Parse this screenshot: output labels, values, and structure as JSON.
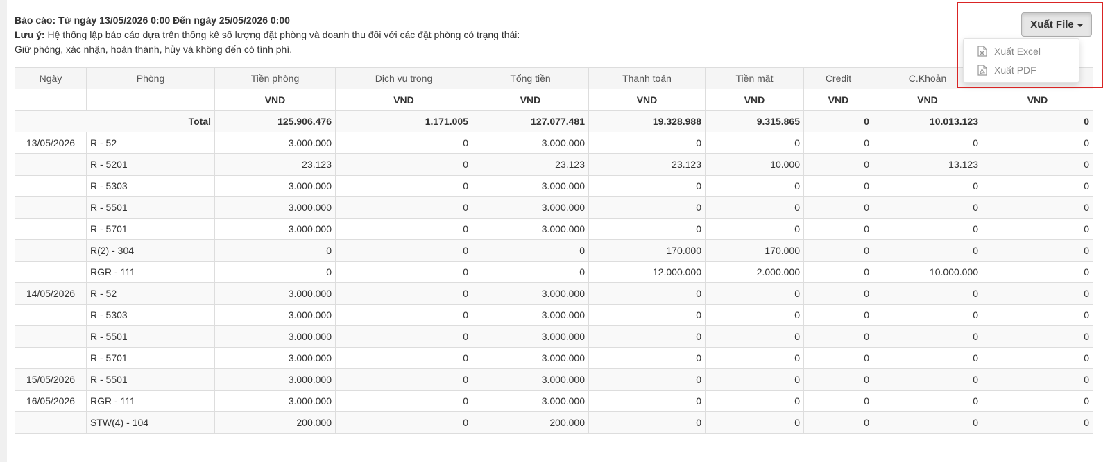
{
  "report": {
    "title": "Báo cáo: Từ ngày 13/05/2026 0:00 Đến ngày 25/05/2026 0:00",
    "note_label": "Lưu ý:",
    "note_text": " Hệ thống lập báo cáo dựa trên thống kê số lượng đặt phòng và doanh thu đối với các đặt phòng có trạng thái:",
    "note_line2": "Giữ phòng, xác nhận, hoàn thành, hủy và không đến có tính phí."
  },
  "export": {
    "button_label": "Xuất File",
    "menu": [
      {
        "label": "Xuất Excel",
        "icon": "excel-file-icon"
      },
      {
        "label": "Xuất PDF",
        "icon": "pdf-file-icon"
      }
    ]
  },
  "table": {
    "columns": [
      "Ngày",
      "Phòng",
      "Tiền phòng",
      "Dịch vụ trong",
      "Tổng tiền",
      "Thanh toán",
      "Tiền mặt",
      "Credit",
      "C.Khoản",
      ""
    ],
    "units": [
      "",
      "",
      "VND",
      "VND",
      "VND",
      "VND",
      "VND",
      "VND",
      "VND",
      "VND"
    ],
    "total": {
      "label": "Total",
      "values": [
        "125.906.476",
        "1.171.005",
        "127.077.481",
        "19.328.988",
        "9.315.865",
        "0",
        "10.013.123",
        "0"
      ]
    },
    "rows": [
      {
        "date": "13/05/2026",
        "room": "R - 52",
        "values": [
          "3.000.000",
          "0",
          "3.000.000",
          "0",
          "0",
          "0",
          "0",
          "0"
        ]
      },
      {
        "date": "",
        "room": "R - 5201",
        "values": [
          "23.123",
          "0",
          "23.123",
          "23.123",
          "10.000",
          "0",
          "13.123",
          "0"
        ]
      },
      {
        "date": "",
        "room": "R - 5303",
        "values": [
          "3.000.000",
          "0",
          "3.000.000",
          "0",
          "0",
          "0",
          "0",
          "0"
        ]
      },
      {
        "date": "",
        "room": "R - 5501",
        "values": [
          "3.000.000",
          "0",
          "3.000.000",
          "0",
          "0",
          "0",
          "0",
          "0"
        ]
      },
      {
        "date": "",
        "room": "R - 5701",
        "values": [
          "3.000.000",
          "0",
          "3.000.000",
          "0",
          "0",
          "0",
          "0",
          "0"
        ]
      },
      {
        "date": "",
        "room": "R(2) - 304",
        "values": [
          "0",
          "0",
          "0",
          "170.000",
          "170.000",
          "0",
          "0",
          "0"
        ]
      },
      {
        "date": "",
        "room": "RGR - 111",
        "values": [
          "0",
          "0",
          "0",
          "12.000.000",
          "2.000.000",
          "0",
          "10.000.000",
          "0"
        ]
      },
      {
        "date": "14/05/2026",
        "room": "R - 52",
        "values": [
          "3.000.000",
          "0",
          "3.000.000",
          "0",
          "0",
          "0",
          "0",
          "0"
        ]
      },
      {
        "date": "",
        "room": "R - 5303",
        "values": [
          "3.000.000",
          "0",
          "3.000.000",
          "0",
          "0",
          "0",
          "0",
          "0"
        ]
      },
      {
        "date": "",
        "room": "R - 5501",
        "values": [
          "3.000.000",
          "0",
          "3.000.000",
          "0",
          "0",
          "0",
          "0",
          "0"
        ]
      },
      {
        "date": "",
        "room": "R - 5701",
        "values": [
          "3.000.000",
          "0",
          "3.000.000",
          "0",
          "0",
          "0",
          "0",
          "0"
        ]
      },
      {
        "date": "15/05/2026",
        "room": "R - 5501",
        "values": [
          "3.000.000",
          "0",
          "3.000.000",
          "0",
          "0",
          "0",
          "0",
          "0"
        ]
      },
      {
        "date": "16/05/2026",
        "room": "RGR - 111",
        "values": [
          "3.000.000",
          "0",
          "3.000.000",
          "0",
          "0",
          "0",
          "0",
          "0"
        ]
      },
      {
        "date": "",
        "room": "STW(4) - 104",
        "values": [
          "200.000",
          "0",
          "200.000",
          "0",
          "0",
          "0",
          "0",
          "0"
        ]
      }
    ]
  }
}
